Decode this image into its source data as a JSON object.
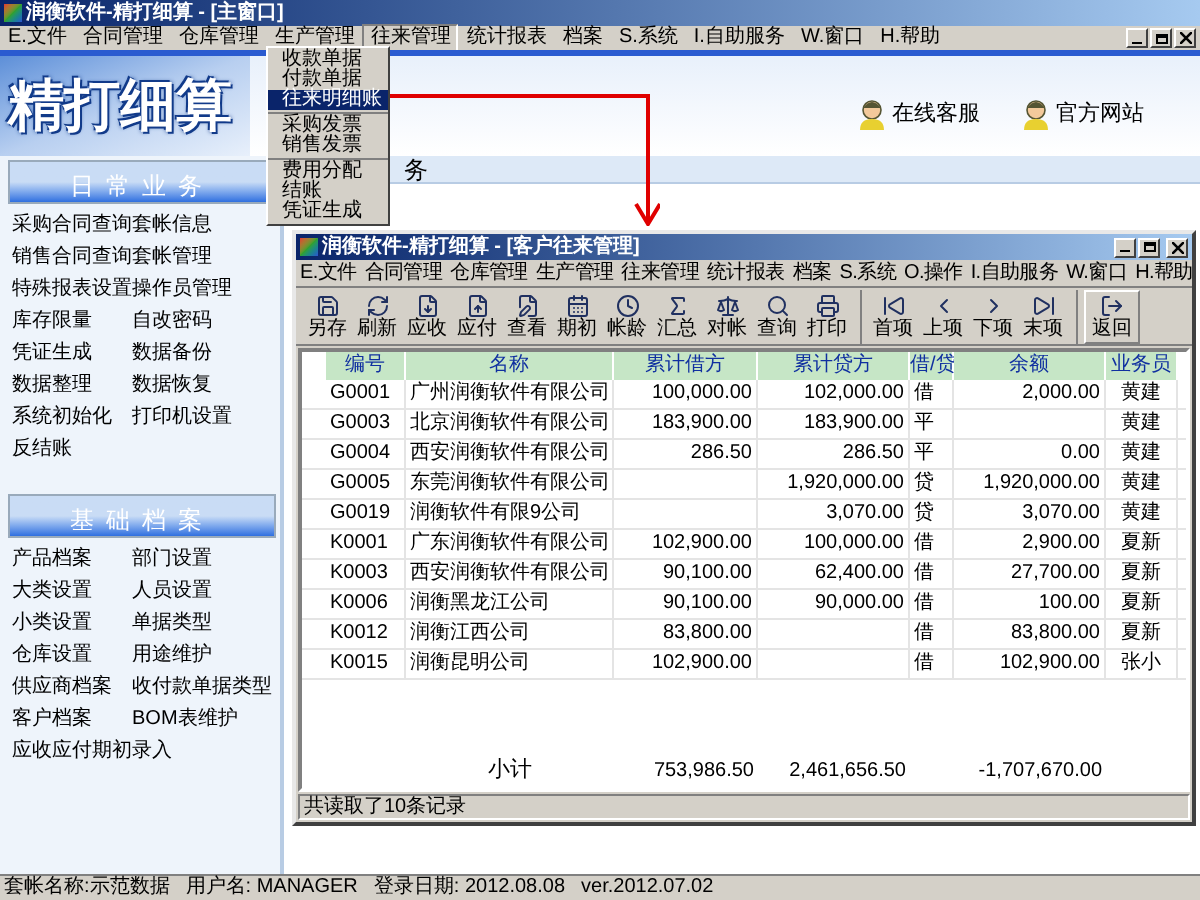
{
  "window": {
    "title": "润衡软件-精打细算 - [主窗口]"
  },
  "menu": [
    {
      "label": "E.文件",
      "selected": false
    },
    {
      "label": "合同管理",
      "selected": false
    },
    {
      "label": "仓库管理",
      "selected": false
    },
    {
      "label": "生产管理",
      "selected": false
    },
    {
      "label": "往来管理",
      "selected": true
    },
    {
      "label": "统计报表",
      "selected": false
    },
    {
      "label": "档案",
      "selected": false
    },
    {
      "label": "S.系统",
      "selected": false
    },
    {
      "label": "I.自助服务",
      "selected": false
    },
    {
      "label": "W.窗口",
      "selected": false
    },
    {
      "label": "H.帮助",
      "selected": false
    }
  ],
  "dropdown": {
    "groups": [
      {
        "items": [
          {
            "label": "收款单据",
            "selected": false
          },
          {
            "label": "付款单据",
            "selected": false
          },
          {
            "label": "往来明细账",
            "selected": true
          }
        ]
      },
      {
        "items": [
          {
            "label": "采购发票",
            "selected": false
          },
          {
            "label": "销售发票",
            "selected": false
          }
        ]
      },
      {
        "items": [
          {
            "label": "费用分配",
            "selected": false
          },
          {
            "label": "结账",
            "selected": false
          },
          {
            "label": "凭证生成",
            "selected": false
          }
        ]
      }
    ]
  },
  "banner": {
    "logo": "精打细算",
    "links": [
      "在线客服",
      "官方网站"
    ]
  },
  "sidebar": {
    "sections": [
      {
        "title": "日常业务",
        "items": [
          "采购合同查询",
          "套帐信息",
          "销售合同查询",
          "套帐管理",
          "特殊报表设置",
          "操作员管理",
          "库存限量",
          "自改密码",
          "凭证生成",
          "数据备份",
          "数据整理",
          "数据恢复",
          "系统初始化",
          "打印机设置",
          "反结账"
        ]
      },
      {
        "title": "基础档案",
        "items": [
          "产品档案",
          "部门设置",
          "大类设置",
          "人员设置",
          "小类设置",
          "单据类型",
          "仓库设置",
          "用途维护",
          "供应商档案",
          "收付款单据类型",
          "客户档案",
          "BOM表维护",
          "应收应付期初录入"
        ]
      }
    ]
  },
  "main_panel": {
    "header": "务"
  },
  "child_window": {
    "title": "润衡软件-精打细算 - [客户往来管理]",
    "menu": [
      "E.文件",
      "合同管理",
      "仓库管理",
      "生产管理",
      "往来管理",
      "统计报表",
      "档案",
      "S.系统",
      "O.操作",
      "I.自助服务",
      "W.窗口",
      "H.帮助"
    ],
    "toolbar": [
      {
        "buttons": [
          "另存",
          "刷新",
          "应收",
          "应付",
          "查看",
          "期初",
          "帐龄",
          "汇总",
          "对帐",
          "查询",
          "打印"
        ]
      },
      {
        "buttons": [
          "首项",
          "上项",
          "下项",
          "末项"
        ]
      },
      {
        "buttons": [
          "返回"
        ]
      }
    ],
    "table": {
      "columns": [
        "编号",
        "名称",
        "累计借方",
        "累计贷方",
        "借/贷",
        "余额",
        "业务员"
      ],
      "rows": [
        [
          "G0001",
          "广州润衡软件有限公司",
          "100,000.00",
          "102,000.00",
          "借",
          "2,000.00",
          "黄建"
        ],
        [
          "G0003",
          "北京润衡软件有限公司",
          "183,900.00",
          "183,900.00",
          "平",
          "",
          "黄建"
        ],
        [
          "G0004",
          "西安润衡软件有限公司",
          "286.50",
          "286.50",
          "平",
          "0.00",
          "黄建"
        ],
        [
          "G0005",
          "东莞润衡软件有限公司",
          "",
          "1,920,000.00",
          "贷",
          "1,920,000.00",
          "黄建"
        ],
        [
          "G0019",
          "润衡软件有限9公司",
          "",
          "3,070.00",
          "贷",
          "3,070.00",
          "黄建"
        ],
        [
          "K0001",
          "广东润衡软件有限公司",
          "102,900.00",
          "100,000.00",
          "借",
          "2,900.00",
          "夏新"
        ],
        [
          "K0003",
          "西安润衡软件有限公司",
          "90,100.00",
          "62,400.00",
          "借",
          "27,700.00",
          "夏新"
        ],
        [
          "K0006",
          "润衡黑龙江公司",
          "90,100.00",
          "90,000.00",
          "借",
          "100.00",
          "夏新"
        ],
        [
          "K0012",
          "润衡江西公司",
          "83,800.00",
          "",
          "借",
          "83,800.00",
          "夏新"
        ],
        [
          "K0015",
          "润衡昆明公司",
          "102,900.00",
          "",
          "借",
          "102,900.00",
          "张小"
        ]
      ],
      "subtotal": {
        "label": "小计",
        "debit": "753,986.50",
        "credit": "2,461,656.50",
        "balance": "-1,707,670.00"
      }
    },
    "status": "共读取了10条记录"
  },
  "status_bar": [
    "套帐名称:示范数据",
    "用户名: MANAGER",
    "登录日期: 2012.08.08",
    "ver.2012.07.02"
  ]
}
